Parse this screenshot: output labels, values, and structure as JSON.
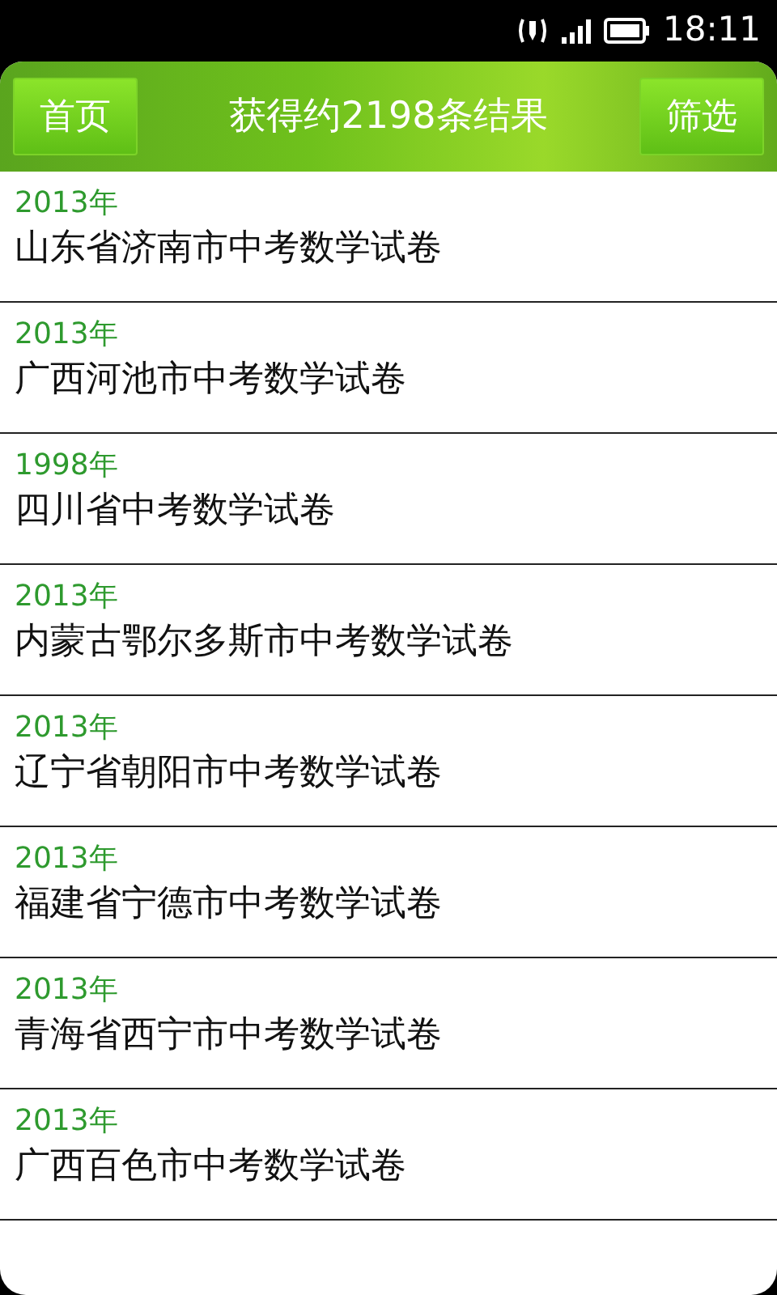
{
  "status_bar": {
    "time": "18:11"
  },
  "header": {
    "left_button": "首页",
    "title": "获得约2198条结果",
    "right_button": "筛选"
  },
  "results": [
    {
      "year": "2013年",
      "title": "山东省济南市中考数学试卷"
    },
    {
      "year": "2013年",
      "title": "广西河池市中考数学试卷"
    },
    {
      "year": "1998年",
      "title": "四川省中考数学试卷"
    },
    {
      "year": "2013年",
      "title": "内蒙古鄂尔多斯市中考数学试卷"
    },
    {
      "year": "2013年",
      "title": "辽宁省朝阳市中考数学试卷"
    },
    {
      "year": "2013年",
      "title": "福建省宁德市中考数学试卷"
    },
    {
      "year": "2013年",
      "title": "青海省西宁市中考数学试卷"
    },
    {
      "year": "2013年",
      "title": "广西百色市中考数学试卷"
    }
  ]
}
